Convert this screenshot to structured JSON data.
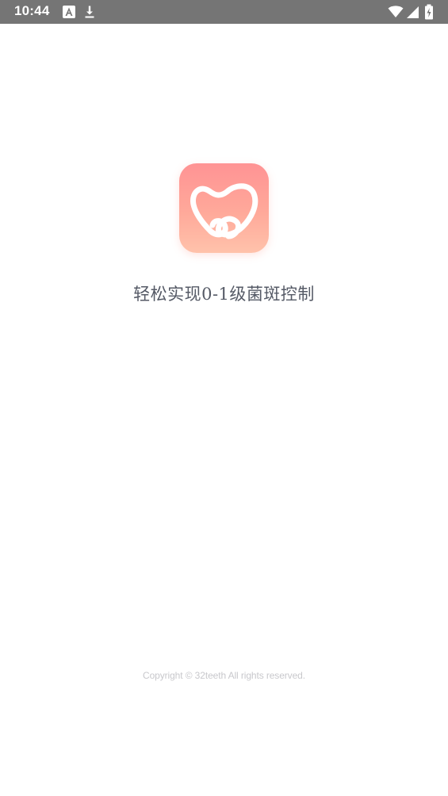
{
  "status_bar": {
    "time": "10:44",
    "icons": [
      "a-notification-icon",
      "download-icon",
      "wifi-icon",
      "signal-icon",
      "battery-charging-icon"
    ],
    "background": "#757575"
  },
  "splash": {
    "logo_icon": "tooth-logo-icon",
    "logo_gradient": [
      "#ff9394",
      "#ffc2ab"
    ],
    "slogan": "轻松实现0-1级菌斑控制",
    "copyright": "Copyright © 32teeth All rights reserved."
  }
}
